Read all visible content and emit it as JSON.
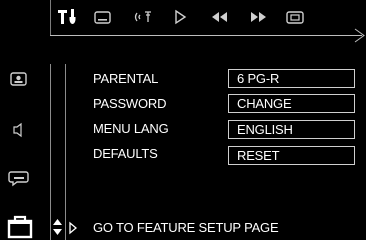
{
  "tabs": [
    {
      "name": "setup-tools-icon"
    },
    {
      "name": "subtitle-icon"
    },
    {
      "name": "audio-icon"
    },
    {
      "name": "play-icon"
    },
    {
      "name": "rewind-icon"
    },
    {
      "name": "fast-forward-icon"
    },
    {
      "name": "display-icon"
    }
  ],
  "menu": {
    "rows": [
      {
        "label": "PARENTAL",
        "value": "6 PG-R"
      },
      {
        "label": "PASSWORD",
        "value": "CHANGE"
      },
      {
        "label": "MENU LANG",
        "value": "ENGLISH"
      },
      {
        "label": "DEFAULTS",
        "value": "RESET"
      }
    ]
  },
  "footer": {
    "text": "GO TO FEATURE SETUP PAGE"
  },
  "sidebar": {
    "items": [
      {
        "name": "general-setup-icon"
      },
      {
        "name": "speaker-setup-icon"
      },
      {
        "name": "dolby-setup-icon"
      },
      {
        "name": "preference-page-icon",
        "selected": true
      }
    ]
  },
  "colors": {
    "background": "#000000",
    "foreground": "#ffffff",
    "border": "#cfcfcf"
  }
}
